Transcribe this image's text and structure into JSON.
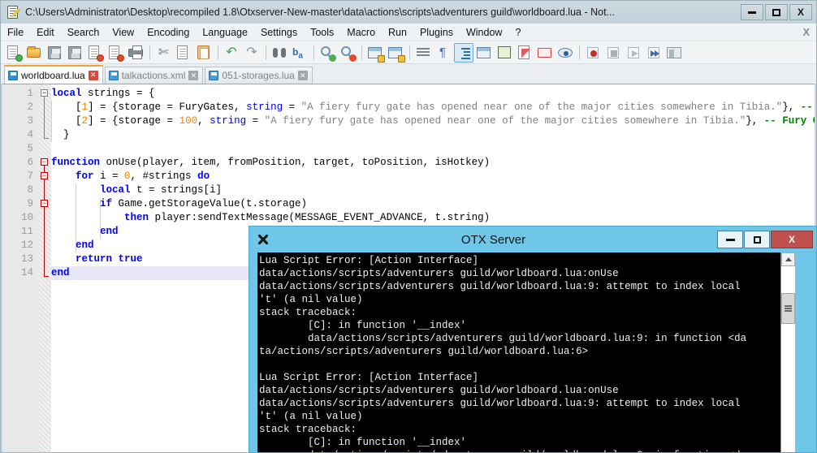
{
  "npp": {
    "title": "C:\\Users\\Administrator\\Desktop\\recompiled 1.8\\Otxserver-New-master\\data\\actions\\scripts\\adventurers guild\\worldboard.lua - Not...",
    "window_buttons": {
      "minimize": "–",
      "maximize": "□",
      "close": "X"
    },
    "menu": [
      "File",
      "Edit",
      "Search",
      "View",
      "Encoding",
      "Language",
      "Settings",
      "Tools",
      "Macro",
      "Run",
      "Plugins",
      "Window",
      "?"
    ],
    "menu_close_doc": "X",
    "toolbar_icons": [
      "new-file-icon",
      "open-file-icon",
      "save-icon",
      "save-all-icon",
      "close-file-icon",
      "close-all-files-icon",
      "print-icon",
      "cut-icon",
      "copy-icon",
      "paste-icon",
      "undo-icon",
      "redo-icon",
      "find-icon",
      "replace-icon",
      "zoom-in-icon",
      "zoom-out-icon",
      "sync-vertical-scroll-icon",
      "sync-horizontal-scroll-icon",
      "word-wrap-icon",
      "show-all-characters-icon",
      "indent-guideline-icon",
      "user-defined-language-icon",
      "document-map-icon",
      "function-list-icon",
      "folder-as-workspace-icon",
      "monitoring-icon",
      "record-macro-icon",
      "stop-recording-icon",
      "play-macro-icon",
      "run-macro-multiple-icon",
      "manage-macros-icon"
    ],
    "tabs": [
      {
        "label": "worldboard.lua",
        "active": true
      },
      {
        "label": "talkactions.xml",
        "active": false
      },
      {
        "label": "051-storages.lua",
        "active": false
      }
    ],
    "editor": {
      "line_numbers": [
        "1",
        "2",
        "3",
        "4",
        "5",
        "6",
        "7",
        "8",
        "9",
        "10",
        "11",
        "12",
        "13",
        "14"
      ],
      "current_line": 14,
      "lines": [
        {
          "n": 1,
          "indent": 0,
          "tokens": [
            {
              "t": "local",
              "c": "kw"
            },
            {
              "t": " strings = {",
              "c": ""
            }
          ]
        },
        {
          "n": 2,
          "indent": 1,
          "tokens": [
            {
              "t": "[",
              "c": ""
            },
            {
              "t": "1",
              "c": "num"
            },
            {
              "t": "] = {storage = FuryGates, ",
              "c": ""
            },
            {
              "t": "string",
              "c": "kw2"
            },
            {
              "t": " = ",
              "c": ""
            },
            {
              "t": "\"A fiery fury gate has opened near one of the major cities somewhere in Tibia.\"",
              "c": "str"
            },
            {
              "t": "}, ",
              "c": ""
            },
            {
              "t": "-- Fury Gat",
              "c": "cmt"
            }
          ]
        },
        {
          "n": 3,
          "indent": 1,
          "tokens": [
            {
              "t": "[",
              "c": ""
            },
            {
              "t": "2",
              "c": "num"
            },
            {
              "t": "] = {storage = ",
              "c": ""
            },
            {
              "t": "100",
              "c": "num"
            },
            {
              "t": ", ",
              "c": ""
            },
            {
              "t": "string",
              "c": "kw2"
            },
            {
              "t": " = ",
              "c": ""
            },
            {
              "t": "\"A fiery fury gate has opened near one of the major cities somewhere in Tibia.\"",
              "c": "str"
            },
            {
              "t": "}, ",
              "c": ""
            },
            {
              "t": "-- Fury Gates",
              "c": "cmt"
            }
          ]
        },
        {
          "n": 4,
          "indent": 0,
          "tokens": [
            {
              "t": "  }",
              "c": ""
            }
          ]
        },
        {
          "n": 5,
          "indent": 0,
          "tokens": [
            {
              "t": "",
              "c": ""
            }
          ]
        },
        {
          "n": 6,
          "indent": 0,
          "tokens": [
            {
              "t": "function",
              "c": "kw"
            },
            {
              "t": " onUse(player, item, fromPosition, target, toPosition, isHotkey)",
              "c": ""
            }
          ]
        },
        {
          "n": 7,
          "indent": 1,
          "tokens": [
            {
              "t": "for",
              "c": "kw"
            },
            {
              "t": " i = ",
              "c": ""
            },
            {
              "t": "0",
              "c": "num"
            },
            {
              "t": ", #strings ",
              "c": ""
            },
            {
              "t": "do",
              "c": "kw"
            }
          ]
        },
        {
          "n": 8,
          "indent": 2,
          "tokens": [
            {
              "t": "local",
              "c": "kw"
            },
            {
              "t": " t = strings[i]",
              "c": ""
            }
          ]
        },
        {
          "n": 9,
          "indent": 2,
          "tokens": [
            {
              "t": "if",
              "c": "kw"
            },
            {
              "t": " Game.getStorageValue(t.storage)",
              "c": ""
            }
          ]
        },
        {
          "n": 10,
          "indent": 3,
          "tokens": [
            {
              "t": "then",
              "c": "kw"
            },
            {
              "t": " player:sendTextMessage(MESSAGE_EVENT_ADVANCE, t.string)",
              "c": ""
            }
          ]
        },
        {
          "n": 11,
          "indent": 2,
          "tokens": [
            {
              "t": "end",
              "c": "kw"
            }
          ]
        },
        {
          "n": 12,
          "indent": 1,
          "tokens": [
            {
              "t": "end",
              "c": "kw"
            }
          ]
        },
        {
          "n": 13,
          "indent": 1,
          "tokens": [
            {
              "t": "return true",
              "c": "kw"
            }
          ]
        },
        {
          "n": 14,
          "indent": 0,
          "tokens": [
            {
              "t": "end",
              "c": "kw"
            }
          ]
        }
      ]
    }
  },
  "otx": {
    "title": "OTX Server",
    "icon": "server-app-icon",
    "window_buttons": {
      "minimize": "–",
      "maximize": "□",
      "close": "X"
    },
    "console_text": "Lua Script Error: [Action Interface]\ndata/actions/scripts/adventurers guild/worldboard.lua:onUse\ndata/actions/scripts/adventurers guild/worldboard.lua:9: attempt to index local\n't' (a nil value)\nstack traceback:\n        [C]: in function '__index'\n        data/actions/scripts/adventurers guild/worldboard.lua:9: in function <da\nta/actions/scripts/adventurers guild/worldboard.lua:6>\n\nLua Script Error: [Action Interface]\ndata/actions/scripts/adventurers guild/worldboard.lua:onUse\ndata/actions/scripts/adventurers guild/worldboard.lua:9: attempt to index local\n't' (a nil value)\nstack traceback:\n        [C]: in function '__index'\n        data/actions/scripts/adventurers guild/worldboard.lua:9: in function <da\nta/actions/scripts/adventurers guild/worldboard.lua:6>\n\nLua Script Error: [Action Interface]\ndata/actions/scripts/adventurers guild/worldboard.lua:onUse",
    "scrollbar": {
      "up_arrow": "▲",
      "thumb": "≡"
    }
  },
  "colors": {
    "npp_title_bg": "#c3d1da",
    "otx_title_bg": "#6ec7e8",
    "otx_close_bg": "#c0504d",
    "console_bg": "#000000",
    "keyword": "#0000ff",
    "string": "#808080",
    "number": "#ff8000",
    "comment": "#008000",
    "active_tab_accent": "#f3a233"
  }
}
